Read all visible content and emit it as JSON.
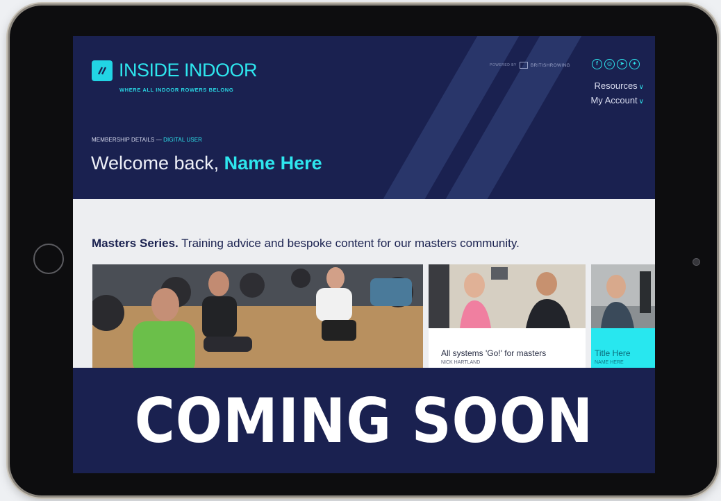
{
  "brand": {
    "name": "INSIDE INDOOR",
    "tagline": "WHERE ALL INDOOR ROWERS BELONG",
    "accent_color": "#2ee6ee",
    "background_color": "#1a2150"
  },
  "partner": {
    "powered_by": "POWERED BY",
    "name": "BRITISHROWING"
  },
  "socials": [
    {
      "icon": "facebook-icon",
      "glyph": "f"
    },
    {
      "icon": "instagram-icon",
      "glyph": "◎"
    },
    {
      "icon": "telegram-icon",
      "glyph": "➤"
    },
    {
      "icon": "twitter-icon",
      "glyph": "✦"
    }
  ],
  "nav": {
    "resources": "Resources",
    "account": "My Account",
    "chevron": "∨"
  },
  "membership": {
    "label": "MEMBERSHIP DETAILS —",
    "type": "DIGITAL USER"
  },
  "welcome": {
    "prefix": "Welcome back,",
    "name": "Name Here"
  },
  "section": {
    "title": "Masters Series.",
    "description": "Training advice and bespoke content for our masters community."
  },
  "cards": [
    {
      "title": "All systems 'Go!' for masters",
      "author": "NICK HARTLAND"
    },
    {
      "title": "Title Here",
      "author": "NAME HERE"
    }
  ],
  "banner": {
    "text": "COMING SOON"
  }
}
